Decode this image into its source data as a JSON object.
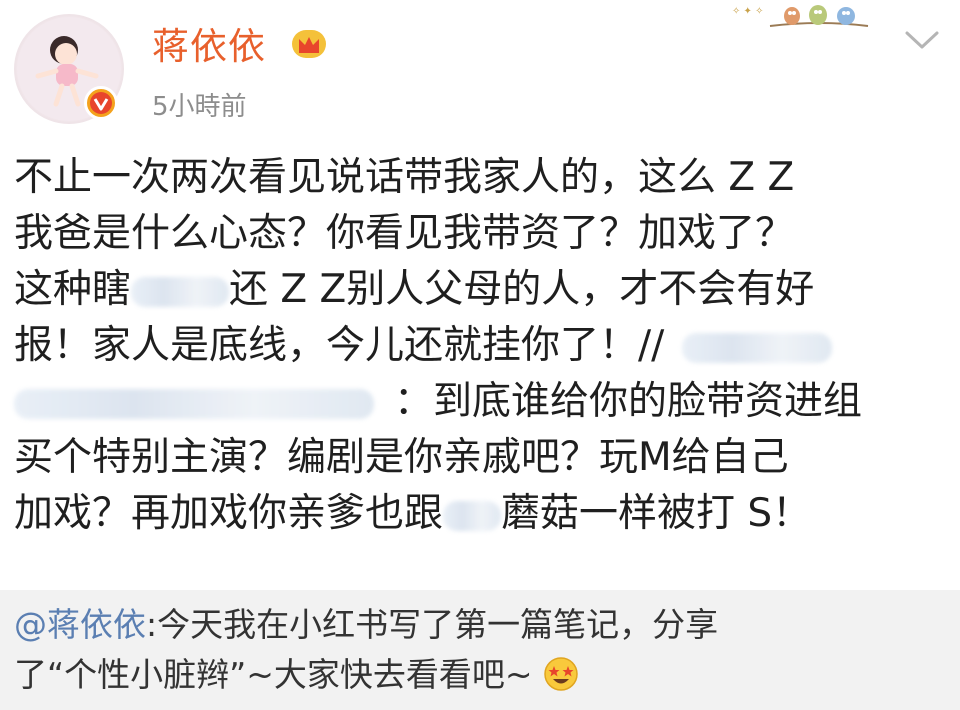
{
  "header": {
    "username": "蒋依依",
    "timestamp": "5小時前",
    "icons": [
      "avatar",
      "verified-icon",
      "crown-icon",
      "birds-decoration-icon",
      "chevron-down-icon"
    ]
  },
  "post": {
    "line1": "不止一次两次看见说话带我家人的，这么 Z Z",
    "line2": "我爸是什么心态？你看见我带资了？加戏了？",
    "line3_a": "这种瞎",
    "line3_b": "还 Z Z别人父母的人，才不会有好",
    "line4": "报！家人是底线，今儿还就挂你了！//",
    "line5": "：到底谁给你的脸带资进组",
    "line6": "买个特别主演？编剧是你亲戚吧？玩M给自己",
    "line7_a": "加戏？再加戏你亲爹也跟",
    "line7_b": "蘑菇一样被打 S！"
  },
  "repost": {
    "mention": "@蒋依依",
    "text1": ":今天我在小红书写了第一篇笔记，分享",
    "text2": "了“个性小脏辫”~大家快去看看吧~",
    "emoji": "star-struck-emoji-icon"
  },
  "colors": {
    "username": "#e8602c",
    "mention": "#5b7fb2",
    "timestamp": "#8d8d8d",
    "repost_bg": "#f2f2f2"
  }
}
